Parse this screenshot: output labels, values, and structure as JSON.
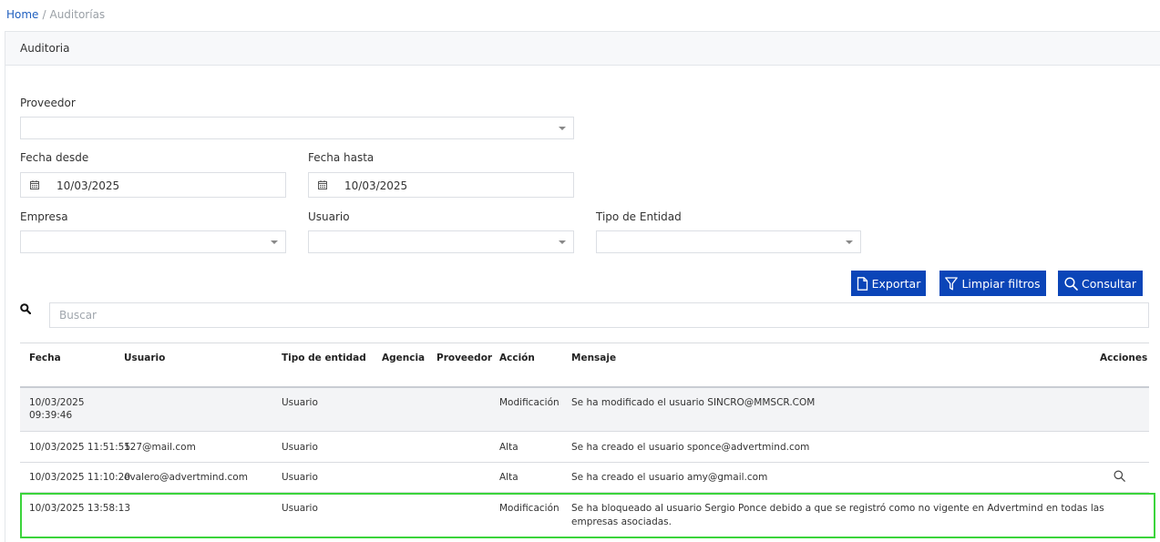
{
  "breadcrumb": {
    "home": "Home",
    "separator": "/",
    "current": "Auditorías"
  },
  "card": {
    "title": "Auditoria"
  },
  "filters": {
    "proveedor": {
      "label": "Proveedor",
      "value": ""
    },
    "fecha_desde": {
      "label": "Fecha desde",
      "value": "10/03/2025"
    },
    "fecha_hasta": {
      "label": "Fecha hasta",
      "value": "10/03/2025"
    },
    "empresa": {
      "label": "Empresa",
      "value": ""
    },
    "usuario": {
      "label": "Usuario",
      "value": ""
    },
    "tipo_entidad": {
      "label": "Tipo de Entidad",
      "value": ""
    }
  },
  "buttons": {
    "exportar": "Exportar",
    "limpiar": "Limpiar filtros",
    "consultar": "Consultar"
  },
  "search": {
    "placeholder": "Buscar"
  },
  "table": {
    "headers": {
      "fecha": "Fecha",
      "usuario": "Usuario",
      "tipo": "Tipo de entidad",
      "agencia": "Agencia",
      "proveedor": "Proveedor",
      "accion": "Acción",
      "mensaje": "Mensaje",
      "acciones": "Acciones"
    },
    "rows": [
      {
        "fecha1": "10/03/2025",
        "fecha2": "09:39:46",
        "usuario": "",
        "tipo": "Usuario",
        "agencia": "",
        "proveedor": "",
        "accion": "Modificación",
        "mensaje1": "Se ha modificado el usuario SINCRO@MMSCR.COM",
        "mensaje2": ""
      },
      {
        "fecha1": "10/03/2025 11:51:55",
        "fecha2": "",
        "usuario": "127@mail.com",
        "tipo": "Usuario",
        "agencia": "",
        "proveedor": "",
        "accion": "Alta",
        "mensaje1": "Se ha creado el usuario sponce@advertmind.com",
        "mensaje2": ""
      },
      {
        "fecha1": "10/03/2025 11:10:20",
        "fecha2": "",
        "usuario": "evalero@advertmind.com",
        "tipo": "Usuario",
        "agencia": "",
        "proveedor": "",
        "accion": "Alta",
        "mensaje1": "Se ha creado el usuario amy@gmail.com",
        "mensaje2": ""
      },
      {
        "fecha1": "10/03/2025 13:58:13",
        "fecha2": "",
        "usuario": "",
        "tipo": "Usuario",
        "agencia": "",
        "proveedor": "",
        "accion": "Modificación",
        "mensaje1": "Se ha bloqueado al usuario Sergio Ponce debido a que se registró como no vigente en Advertmind en todas las",
        "mensaje2": "empresas asociadas."
      }
    ]
  },
  "colors": {
    "primary": "#0b45b8",
    "link": "#1f5fbf",
    "highlight": "#3bd43b"
  },
  "icons": [
    "calendar-icon",
    "file-icon",
    "filter-icon",
    "search-icon",
    "magnifier-icon",
    "caret-down-icon"
  ]
}
